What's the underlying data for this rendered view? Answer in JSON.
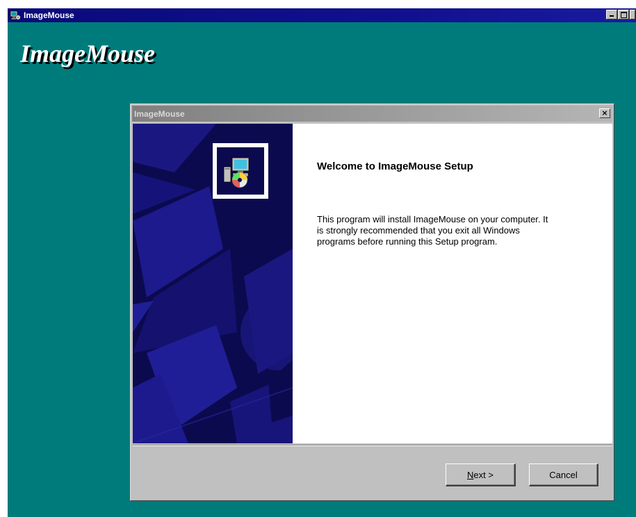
{
  "outer_window": {
    "title": "ImageMouse",
    "banner_title": "ImageMouse"
  },
  "dialog": {
    "title": "ImageMouse",
    "close_label": "×",
    "heading": "Welcome to ImageMouse Setup",
    "body_lines": [
      "This program will install ImageMouse on your computer.  It",
      "is strongly recommended that you exit all Windows",
      "programs before running this Setup program."
    ],
    "next_mnemonic": "N",
    "next_rest": "ext >",
    "cancel_label": "Cancel"
  },
  "colors": {
    "desktop_teal": "#007b7b",
    "title_blue": "#0a0a7a",
    "side_panel_navy": "#0c0a4e",
    "dialog_gray": "#c0c0c0"
  },
  "icons": {
    "outer_title": "setup-computer-icon",
    "installer": "installer-cd-computer-icon"
  }
}
